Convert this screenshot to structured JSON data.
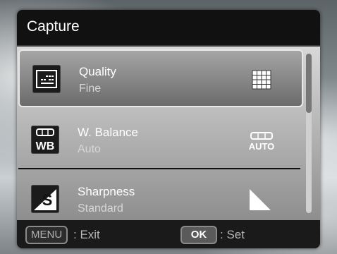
{
  "header": {
    "title": "Capture"
  },
  "menu": {
    "items": [
      {
        "title": "Quality",
        "value": "Fine",
        "icon": "quality-icon",
        "value_icon": "fine-grid-icon",
        "selected": true
      },
      {
        "title": "W. Balance",
        "value": "Auto",
        "icon": "white-balance-icon",
        "value_icon": "auto-wb-icon",
        "icon_text": "WB",
        "value_icon_text": "AUTO"
      },
      {
        "title": "Sharpness",
        "value": "Standard",
        "icon": "sharpness-icon",
        "value_icon": "standard-sharpness-icon",
        "icon_text": "S"
      }
    ],
    "scroll_position": 0.0
  },
  "footer": {
    "menu_key": "MENU",
    "menu_action": ": Exit",
    "ok_key": "OK",
    "ok_action": ": Set"
  }
}
